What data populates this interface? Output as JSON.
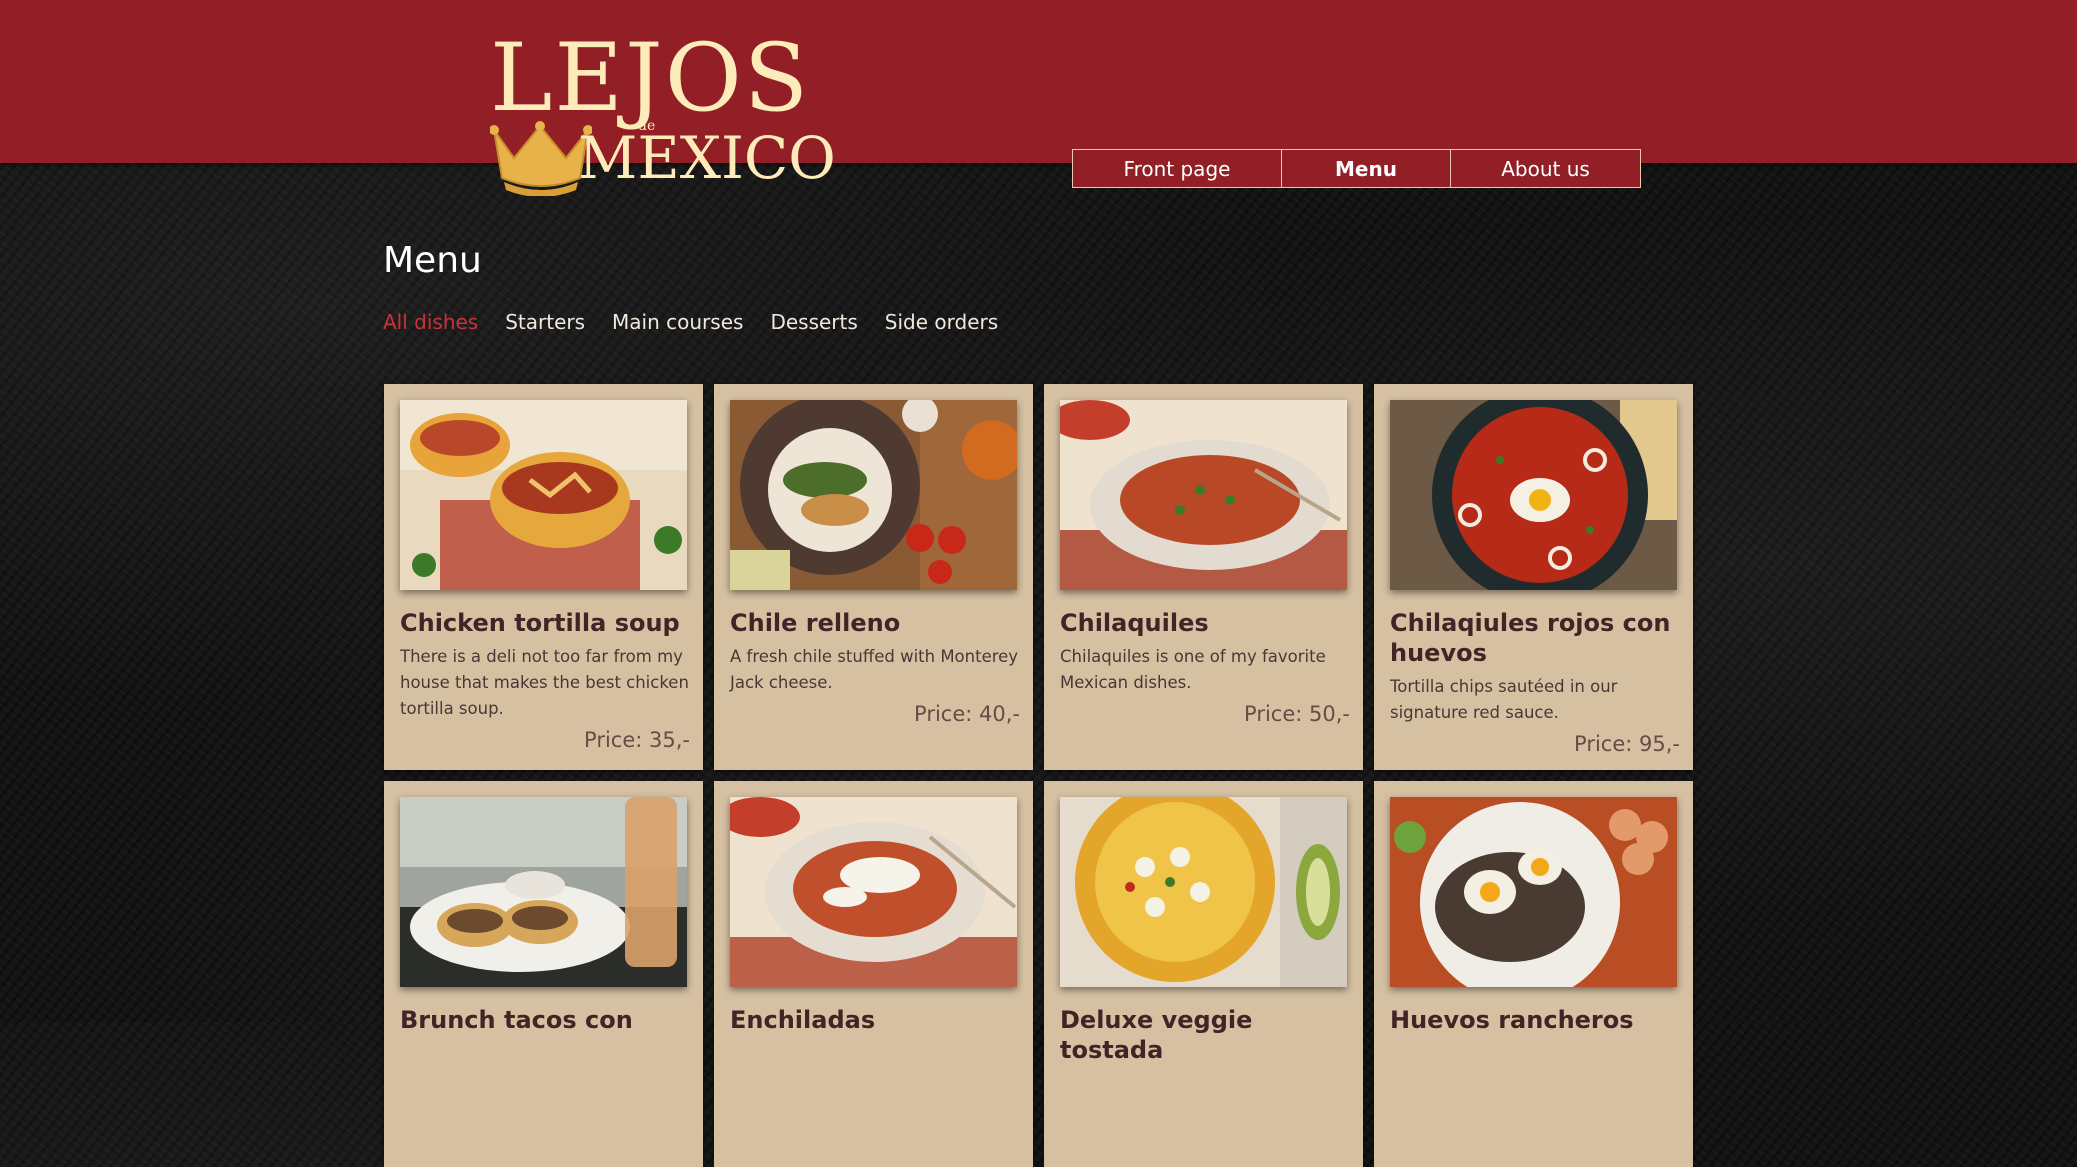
{
  "brand": {
    "logo_word1": "LEJOS",
    "logo_de": "de",
    "logo_word2": "MEXICO",
    "colors": {
      "header": "#921f25",
      "accent": "#c8323b",
      "card": "#d6c0a2",
      "logo": "#fdebb9"
    }
  },
  "nav": {
    "items": [
      {
        "label": "Front page"
      },
      {
        "label": "Menu"
      },
      {
        "label": "About us"
      }
    ],
    "active": "Menu"
  },
  "page": {
    "title": "Menu"
  },
  "filters": [
    {
      "label": "All dishes"
    },
    {
      "label": "Starters"
    },
    {
      "label": "Main courses"
    },
    {
      "label": "Desserts"
    },
    {
      "label": "Side orders"
    }
  ],
  "active_filter": "All dishes",
  "dishes": [
    {
      "name": "Chicken tortilla soup",
      "description": "There is a deli not too far from my house that makes the best chicken tortilla soup.",
      "price": "Price: 35,-"
    },
    {
      "name": "Chile relleno",
      "description": "A fresh chile stuffed with Monterey Jack cheese.",
      "price": "Price: 40,-"
    },
    {
      "name": "Chilaquiles",
      "description": "Chilaquiles is one of my favorite Mexican dishes.",
      "price": "Price: 50,-"
    },
    {
      "name": "Chilaqiules rojos con huevos",
      "description": "Tortilla chips sautéed in our signature red sauce.",
      "price": "Price: 95,-"
    },
    {
      "name": "Brunch tacos con",
      "description": "",
      "price": ""
    },
    {
      "name": "Enchiladas",
      "description": "",
      "price": ""
    },
    {
      "name": "Deluxe veggie tostada",
      "description": "",
      "price": ""
    },
    {
      "name": "Huevos rancheros",
      "description": "",
      "price": ""
    }
  ]
}
